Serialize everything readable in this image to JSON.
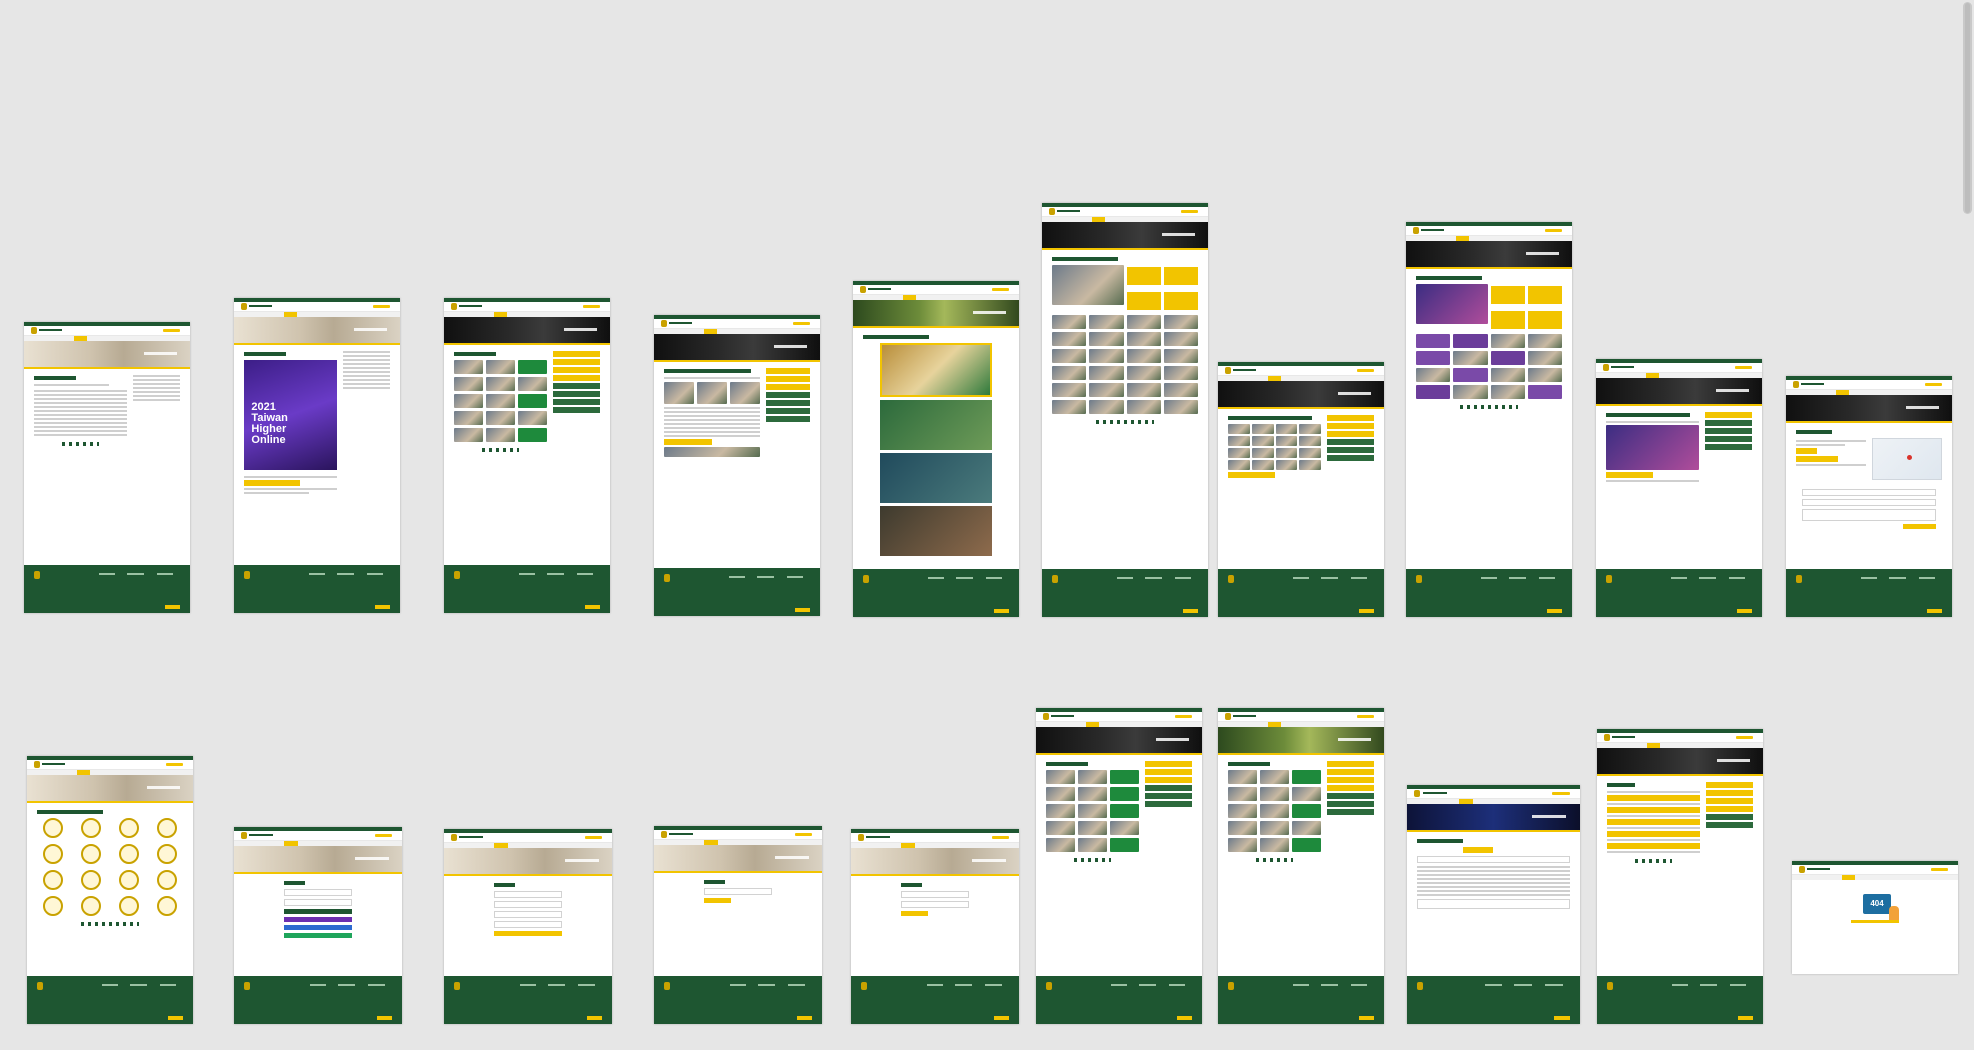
{
  "canvas": {
    "background": "#e6e6e6"
  },
  "colors": {
    "brand_green": "#1e5631",
    "brand_yellow": "#f2c400"
  },
  "boards": [
    {
      "id": "news-list",
      "hero": "light"
    },
    {
      "id": "event-poster",
      "hero": "light",
      "poster_lines": "2021\nTaiwan\nHigher\nOnline"
    },
    {
      "id": "news-grid-1",
      "hero": "dark"
    },
    {
      "id": "article-detail",
      "hero": "dark"
    },
    {
      "id": "services",
      "hero": "green"
    },
    {
      "id": "gallery-long",
      "hero": "dark"
    },
    {
      "id": "gallery-detail",
      "hero": "dark"
    },
    {
      "id": "video-gallery",
      "hero": "dark"
    },
    {
      "id": "video-detail",
      "hero": "dark"
    },
    {
      "id": "contact-map",
      "hero": "dark"
    },
    {
      "id": "agencies-seals",
      "hero": "light"
    },
    {
      "id": "login",
      "hero": "light"
    },
    {
      "id": "register",
      "hero": "light"
    },
    {
      "id": "forgot-password",
      "hero": "light"
    },
    {
      "id": "reset-password",
      "hero": "light"
    },
    {
      "id": "news-grid-2",
      "hero": "dark"
    },
    {
      "id": "news-grid-3",
      "hero": "green"
    },
    {
      "id": "webboard",
      "hero": "blue"
    },
    {
      "id": "faq-list",
      "hero": "dark"
    },
    {
      "id": "error-404",
      "hero": "none",
      "error_code": "404"
    }
  ]
}
